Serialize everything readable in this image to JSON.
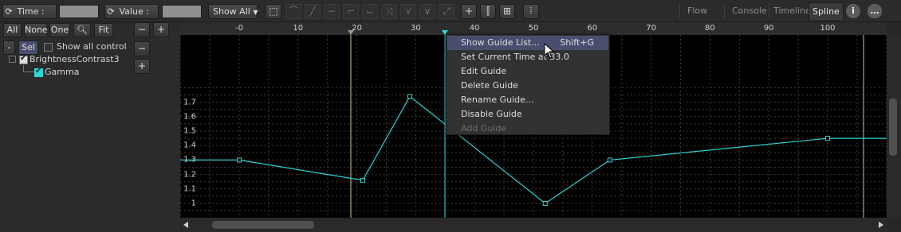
{
  "toolbar": {
    "time_label": "Time :",
    "value_label": "Value :",
    "show_all_label": "Show All",
    "tabs": [
      {
        "label": "Flow",
        "active": false
      },
      {
        "label": "Console",
        "active": false
      },
      {
        "label": "Timeline",
        "active": false
      },
      {
        "label": "Spline",
        "active": true
      }
    ]
  },
  "left_panel": {
    "buttons": {
      "all": "All",
      "none": "None",
      "one": "One",
      "fit": "Fit",
      "minus": "-",
      "sel": "Sel"
    },
    "show_all_control_label": "Show all control",
    "tree": [
      {
        "label": "BrightnessContrast3",
        "checked": true
      },
      {
        "label": "Gamma",
        "checked": true
      }
    ]
  },
  "ruler": {
    "ticks": [
      "-0",
      "10",
      "20",
      "30",
      "40",
      "50",
      "60",
      "70",
      "80",
      "90",
      "100"
    ]
  },
  "y_axis": {
    "ticks": [
      "1.7",
      "1.6",
      "1.5",
      "1.4",
      "1.3",
      "1.2",
      "1.1",
      "1"
    ]
  },
  "spline": {
    "color": "#2fd4d4",
    "keyframes": [
      {
        "frame": 0,
        "value": 1.3
      },
      {
        "frame": 21,
        "value": 1.16
      },
      {
        "frame": 29,
        "value": 1.74
      },
      {
        "frame": 52,
        "value": 1.0
      },
      {
        "frame": 63,
        "value": 1.3
      },
      {
        "frame": 100,
        "value": 1.45
      }
    ]
  },
  "guides": {
    "color": "#c8c8a0",
    "current_time_color": "#2fd4d4"
  },
  "context_menu": {
    "items": [
      {
        "label": "Show Guide List...",
        "shortcut": "Shift+G",
        "highlight": true,
        "disabled": false
      },
      {
        "label": "Set Current Time at 33.0",
        "shortcut": "",
        "highlight": false,
        "disabled": false
      },
      {
        "label": "Edit Guide",
        "shortcut": "",
        "highlight": false,
        "disabled": false
      },
      {
        "label": "Delete Guide",
        "shortcut": "",
        "highlight": false,
        "disabled": false
      },
      {
        "label": "Rename Guide...",
        "shortcut": "",
        "highlight": false,
        "disabled": false
      },
      {
        "label": "Disable Guide",
        "shortcut": "",
        "highlight": false,
        "disabled": false
      },
      {
        "label": "Add Guide",
        "shortcut": "",
        "highlight": false,
        "disabled": true
      }
    ]
  }
}
